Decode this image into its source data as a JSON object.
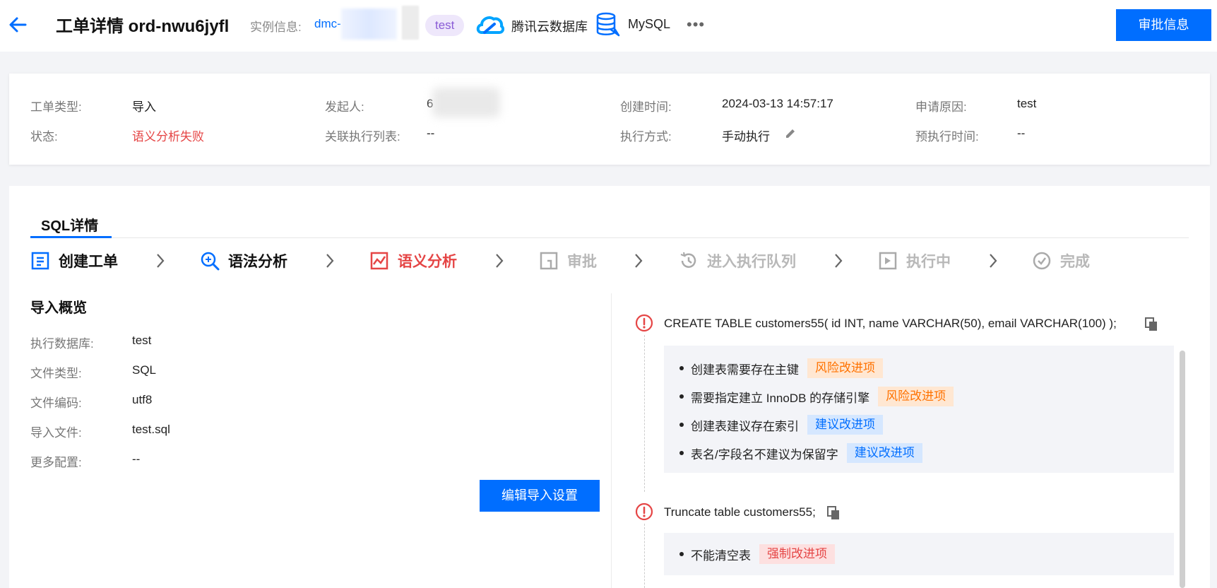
{
  "header": {
    "title": "工单详情 ord-nwu6jyfl",
    "instance_label": "实例信息:",
    "instance_link": "dmc-",
    "instance_tag": "test",
    "cloud_db_label": "腾讯云数据库",
    "db_type_label": "MySQL",
    "more_label": "•••",
    "approve_button": "审批信息"
  },
  "info": {
    "ticket_type_label": "工单类型:",
    "ticket_type_value": "导入",
    "status_label": "状态:",
    "status_value": "语义分析失败",
    "initiator_label": "发起人:",
    "initiator_value": "6",
    "exec_list_label": "关联执行列表:",
    "exec_list_value": "--",
    "created_label": "创建时间:",
    "created_value": "2024-03-13 14:57:17",
    "exec_mode_label": "执行方式:",
    "exec_mode_value": "手动执行",
    "reason_label": "申请原因:",
    "reason_value": "test",
    "pre_exec_label": "预执行时间:",
    "pre_exec_value": "--"
  },
  "tabs": {
    "sql_detail": "SQL详情"
  },
  "steps": [
    {
      "label": "创建工单",
      "state": "done"
    },
    {
      "label": "语法分析",
      "state": "done"
    },
    {
      "label": "语义分析",
      "state": "failed"
    },
    {
      "label": "审批",
      "state": "pending"
    },
    {
      "label": "进入执行队列",
      "state": "pending"
    },
    {
      "label": "执行中",
      "state": "pending"
    },
    {
      "label": "完成",
      "state": "pending"
    }
  ],
  "overview": {
    "title": "导入概览",
    "rows": [
      {
        "label": "执行数据库:",
        "value": "test"
      },
      {
        "label": "文件类型:",
        "value": "SQL"
      },
      {
        "label": "文件编码:",
        "value": "utf8"
      },
      {
        "label": "导入文件:",
        "value": "test.sql"
      },
      {
        "label": "更多配置:",
        "value": "--"
      }
    ],
    "edit_button": "编辑导入设置"
  },
  "statements": [
    {
      "sql": "CREATE TABLE customers55( id INT, name VARCHAR(50), email VARCHAR(100) );",
      "issues": [
        {
          "text": "创建表需要存在主键",
          "badge": "风险改进项",
          "level": "orange"
        },
        {
          "text": "需要指定建立 InnoDB 的存储引擎",
          "badge": "风险改进项",
          "level": "orange"
        },
        {
          "text": "创建表建议存在索引",
          "badge": "建议改进项",
          "level": "blue"
        },
        {
          "text": "表名/字段名不建议为保留字",
          "badge": "建议改进项",
          "level": "blue"
        }
      ]
    },
    {
      "sql": "Truncate table customers55;",
      "issues": [
        {
          "text": "不能清空表",
          "badge": "强制改进项",
          "level": "red"
        }
      ]
    }
  ],
  "colors": {
    "primary": "#006eff",
    "error": "#e54545",
    "warning": "#ff7200",
    "tag_purple": "#8a5bd6"
  }
}
